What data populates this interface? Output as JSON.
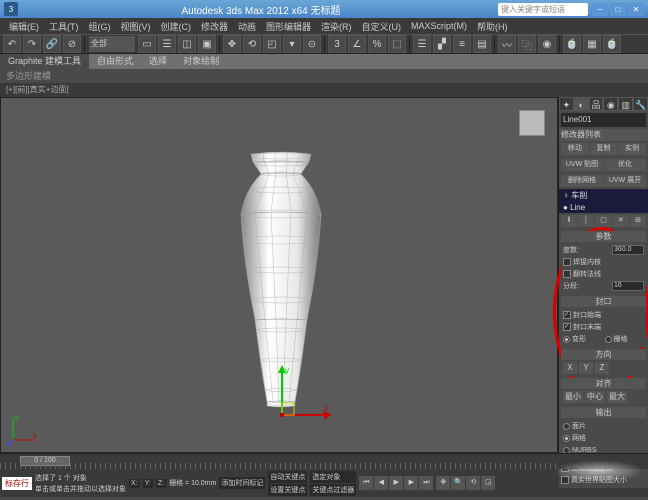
{
  "title": "Autodesk 3ds Max 2012 x64   无标题",
  "search_placeholder": "键入关键字或短语",
  "menu": [
    "编辑(E)",
    "工具(T)",
    "组(G)",
    "视图(V)",
    "创建(C)",
    "修改器",
    "动画",
    "图形编辑器",
    "渲染(R)",
    "自定义(U)",
    "MAXScript(M)",
    "帮助(H)"
  ],
  "toolbar_select": "全部",
  "ribbon": {
    "tabs": [
      "Graphite 建模工具",
      "自由形式",
      "选择",
      "对象绘制"
    ],
    "sub": "多边形建模"
  },
  "crumb_left": "[+][前][真实+边面]",
  "viewport_label": "前",
  "object_name": "Line001",
  "mod_header": "修改器列表",
  "mod_items": [
    "车削",
    "Line"
  ],
  "btnrow1": [
    "移动",
    "复制",
    "实例"
  ],
  "btnrow2": [
    "UVW 贴图",
    "优化"
  ],
  "btnrow3": [
    "删除网格",
    "UVW 展开"
  ],
  "stackbtns": [
    "‖",
    "│",
    "▢",
    "✕",
    "⊞"
  ],
  "rollouts": {
    "params": {
      "title": "参数",
      "degrees_label": "度数:",
      "degrees_value": "360.0",
      "weld_label": "焊接内核",
      "flip_label": "翻转法线",
      "segs_label": "分段:",
      "segs_value": "16"
    },
    "cap": {
      "title": "封口",
      "start": "封口始端",
      "end": "封口末端",
      "morph": "变形",
      "grid": "栅格"
    },
    "dir": {
      "title": "方向",
      "axes": [
        "X",
        "Y",
        "Z"
      ]
    },
    "align": {
      "title": "对齐",
      "opts": [
        "最小",
        "中心",
        "最大"
      ]
    },
    "output": {
      "title": "输出",
      "opts": [
        "面片",
        "网格",
        "NURBS"
      ]
    },
    "gen": {
      "label1": "生成贴图坐标",
      "label2": "真实世界贴图大小"
    }
  },
  "time_label": "0 / 100",
  "status": {
    "tag": "标存行",
    "sel": "选择了 1 个 对象",
    "hint": "单击或单击并拖动以选择对象",
    "coords_hint": "添加时间标记",
    "x": "X:",
    "y": "Y:",
    "z": "Z:",
    "grid": "栅格 = 10.0mm",
    "autokey": "自动关键点",
    "setkey": "设置关键点",
    "selobj": "选定对象",
    "filter": "关键点过滤器"
  }
}
